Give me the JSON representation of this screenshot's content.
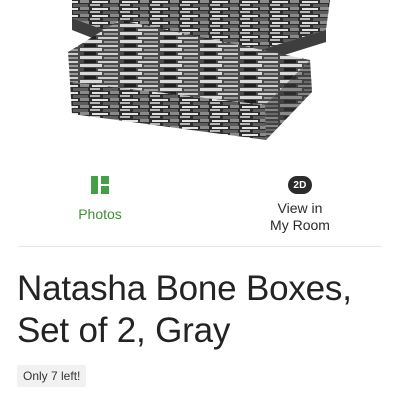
{
  "media_tabs": {
    "photos": {
      "label": "Photos",
      "icon": "photos-grid-icon",
      "color": "#43a047"
    },
    "view_in_room": {
      "badge": "2D",
      "label_line1": "View in",
      "label_line2": "My Room"
    }
  },
  "product": {
    "title_line1": "Natasha Bone Boxes,",
    "title_line2": "Set of 2, Gray",
    "stock": "Only 7 left!"
  }
}
